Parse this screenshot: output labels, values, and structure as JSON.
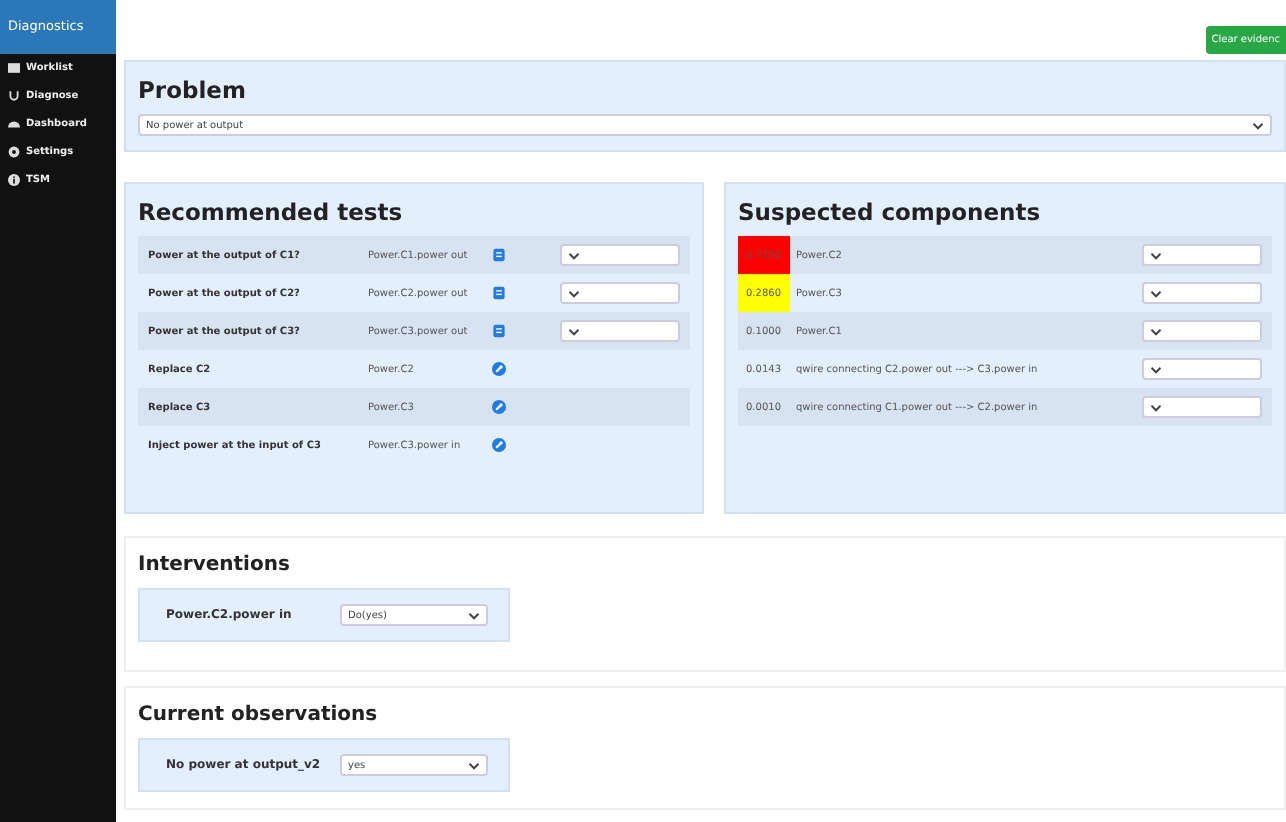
{
  "sidebar": {
    "title": "Diagnostics",
    "items": [
      {
        "label": "Worklist"
      },
      {
        "label": "Diagnose"
      },
      {
        "label": "Dashboard"
      },
      {
        "label": "Settings"
      },
      {
        "label": "TSM"
      }
    ]
  },
  "clear_button": "Clear evidenc",
  "problem": {
    "title": "Problem",
    "value": "No power at output"
  },
  "tests": {
    "title": "Recommended tests",
    "rows": [
      {
        "name": "Power at the output of C1?",
        "variable": "Power.C1.power out",
        "kind": "question"
      },
      {
        "name": "Power at the output of C2?",
        "variable": "Power.C2.power out",
        "kind": "question"
      },
      {
        "name": "Power at the output of C3?",
        "variable": "Power.C3.power out",
        "kind": "question"
      },
      {
        "name": "Replace C2",
        "variable": "Power.C2",
        "kind": "action"
      },
      {
        "name": "Replace C3",
        "variable": "Power.C3",
        "kind": "action"
      },
      {
        "name": "Inject power at the input of C3",
        "variable": "Power.C3.power in",
        "kind": "action"
      }
    ]
  },
  "suspects": {
    "title": "Suspected components",
    "rows": [
      {
        "score": "0.7150",
        "name": "Power.C2",
        "color": "#ff0000"
      },
      {
        "score": "0.2860",
        "name": "Power.C3",
        "color": "#ffff00"
      },
      {
        "score": "0.1000",
        "name": "Power.C1"
      },
      {
        "score": "0.0143",
        "name": "qwire connecting C2.power out ---> C3.power in"
      },
      {
        "score": "0.0010",
        "name": "qwire connecting C1.power out ---> C2.power in"
      }
    ]
  },
  "interventions": {
    "title": "Interventions",
    "items": [
      {
        "label": "Power.C2.power in",
        "value": "Do(yes)"
      }
    ]
  },
  "observations": {
    "title": "Current observations",
    "items": [
      {
        "label": "No power at output_v2",
        "value": "yes"
      }
    ]
  }
}
